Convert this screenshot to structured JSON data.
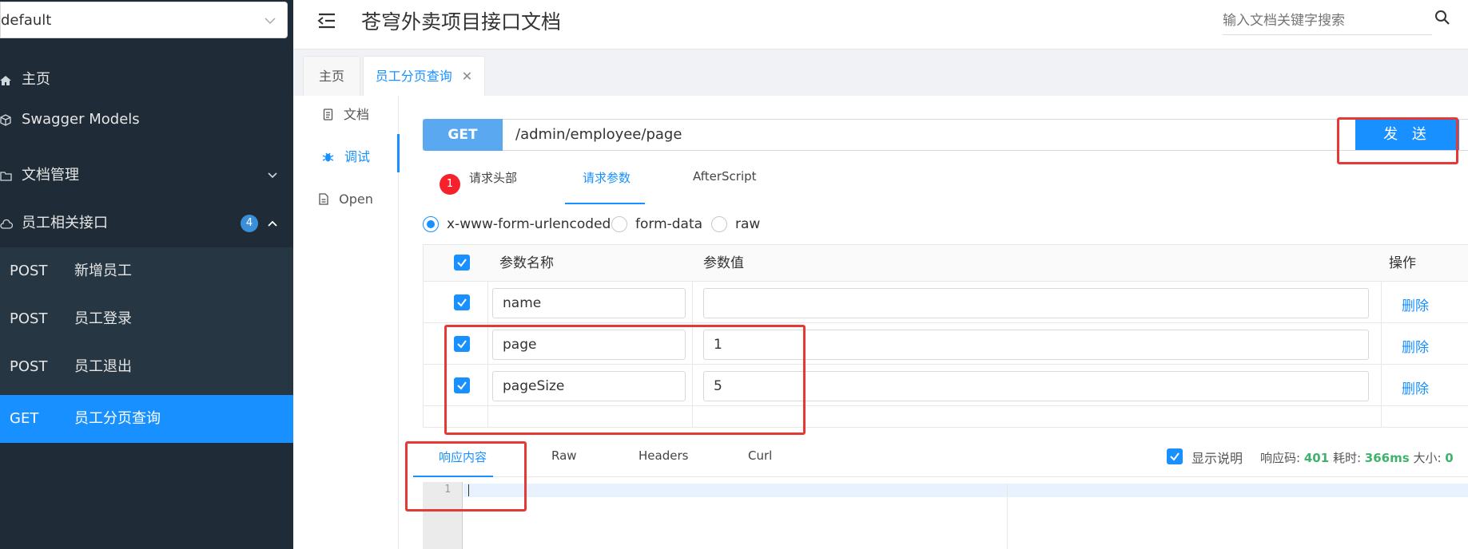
{
  "sidebar": {
    "group_select": "default",
    "menu": [
      {
        "label": "主页",
        "icon": "home-icon"
      },
      {
        "label": "Swagger Models",
        "icon": "cube-icon"
      },
      {
        "label": "文档管理",
        "icon": "folder-icon"
      },
      {
        "label": "员工相关接口",
        "icon": "cloud-icon",
        "badge": "4"
      }
    ],
    "sub_items": [
      {
        "method": "POST",
        "title": "新增员工"
      },
      {
        "method": "POST",
        "title": "员工登录"
      },
      {
        "method": "POST",
        "title": "员工退出"
      },
      {
        "method": "GET",
        "title": "员工分页查询",
        "active": true
      }
    ]
  },
  "header": {
    "title": "苍穹外卖项目接口文档",
    "search_placeholder": "输入文档关键字搜索"
  },
  "tabs": [
    {
      "label": "主页"
    },
    {
      "label": "员工分页查询",
      "active": true
    }
  ],
  "side_tabs": [
    {
      "label": "文档"
    },
    {
      "label": "调试",
      "active": true
    },
    {
      "label": "Open"
    }
  ],
  "request": {
    "method": "GET",
    "url": "/admin/employee/page",
    "send_label": "发 送"
  },
  "request_tabs": {
    "headers_label": "请求头部",
    "headers_count": "1",
    "params_label": "请求参数",
    "afterscript_label": "AfterScript"
  },
  "content_types": [
    "x-www-form-urlencoded",
    "form-data",
    "raw"
  ],
  "params_table": {
    "headers": {
      "name": "参数名称",
      "value": "参数值",
      "action": "操作"
    },
    "rows": [
      {
        "name": "name",
        "value": "",
        "action": "删除"
      },
      {
        "name": "page",
        "value": "1",
        "action": "删除"
      },
      {
        "name": "pageSize",
        "value": "5",
        "action": "删除"
      }
    ]
  },
  "response": {
    "tabs": [
      "响应内容",
      "Raw",
      "Headers",
      "Curl"
    ],
    "show_desc_label": "显示说明",
    "code_label": "响应码:",
    "code": "401",
    "time_label": "耗时:",
    "time": "366ms",
    "size_label": "大小:",
    "size": "0",
    "line_number": "1"
  },
  "colors": {
    "accent": "#1890ff",
    "sidebar_bg": "#1f2c37",
    "annotation_red": "#e53935",
    "success_green": "#3fb36b"
  }
}
